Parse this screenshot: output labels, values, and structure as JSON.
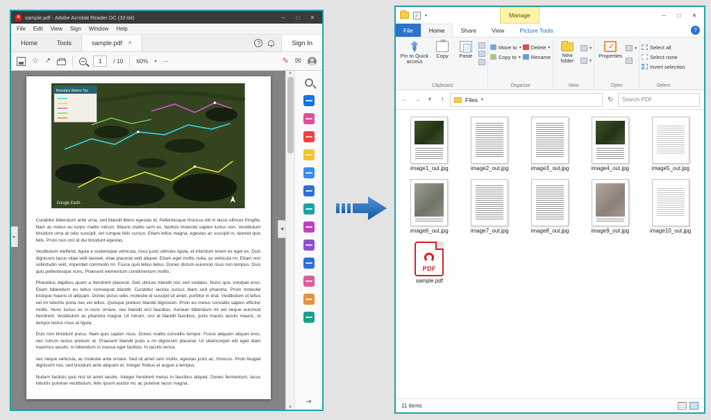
{
  "icons": {
    "minimize": "─",
    "maximize": "□",
    "close": "✕",
    "help": "?",
    "ellipsis": "⋯",
    "chevron": "▾",
    "star": "☆",
    "pen": "✎",
    "mail": "✉",
    "back": "←",
    "forward": "→",
    "up": "↑",
    "refresh": "↻",
    "collapse_left": "◀",
    "panel_arrow": "▸",
    "scroll_up": "▲",
    "scroll_down": "▼",
    "share": "↗",
    "fit": "⇥",
    "pdf_badge": "A"
  },
  "acrobat": {
    "title": "sample.pdf - Adobe Acrobat Reader DC (32-bit)",
    "menu": [
      "File",
      "Edit",
      "View",
      "Sign",
      "Window",
      "Help"
    ],
    "tabs": {
      "home": "Home",
      "tools": "Tools",
      "document": "sample.pdf"
    },
    "sign_in": "Sign In",
    "toolbar": {
      "page_current": "1",
      "page_total": "/ 10",
      "zoom": "60%"
    },
    "document": {
      "map": {
        "legend_title": "Boundary Waters Trip",
        "credit": "Google Earth"
      },
      "paragraphs": [
        "Curabitur bibendum ante urna, sed blandit libero egestas id. Pellentesque rhoncus elit in lacus ultrices fringilla. Nam ac metus eu turpis mattis rutrum. Mauris mattis sem ex, facilisis molestie sapien luctus non. Vestibulum tincidunt urna at odio suscipit, vel congue felis cursus. Etiam tellus magna, egestas ac suscipit in, laoreet quis felis. Proin non orci id dui tincidunt egestas.",
        "Vestibulum eleifend, ligula a scelerisque vehicula, risus justo ultricies ligula, et interdum lorem ex eget ex. Duis dignissim lacus vitae velit laoreet, vitae placerat velit aliquet. Etiam eget mollis nulla, ac vehicula mi. Etiam non sollicitudin velit, imperdiet commodo mi. Fusce quis tellus tellus. Donec dictum euismod risus non tempus. Duis quis pellentesque nunc. Praesent elementum condimentum mollis.",
        "Phasellus dapibus quam a hendrerit placerat. Sed ultrices blandit nisl sed sodales. Nunc quis volutpat eros. Etiam bibendum eu tellus consequat blandit. Curabitur lacinia cursus diam sed pharetra. Proin molestie tristique mauris ut aliquam. Donec purus odio, molestie id suscipit sit amet, porttitor in erat. Vestibulum ut tellus vel mi lobortis porta nec vel tellus. Quisque pretium blandit dignissim. Proin eu metus convallis sapien efficitur mollis. Nunc luctus ex in nunc ornare, nec blandit orci faucibus. Aenean bibendum mi vel neque euismod hendrerit. Vestibulum ac pharetra magna. Ut rutrum, orci at blandit faucibus, justo mauris iaculis mauris, ut tempor lectus risus at ligula.",
        "Duis non tincidunt purus. Nam quis sapien risus. Donec mattis convallis tempor. Fusce aliquam aliquet eros, nec rutrum lectus pretium at. Praesent blandit justo a mi dignissim placerat. Ut ullamcorper elit eget diam maximus iaculis. In bibendum in massa eget facilisis. In iaculis lectus",
        "nec neque vehicula, ac molestie ante ornare. Sed sit amet sem mollis, egestas justo ac, rhoncus. Proin feugiat dignissim nisi, sed tincidunt ante aliquam et. Integer finibus et augue a tempus.",
        "Nullam facilisis quis nisl sit amet iaculis. Integer hendrerit metus in faucibus aliquet. Donec fermentum, lacus lobortis pulvinar vestibulum, felis ipsum auctor mi, ac pulvinar lacus magna."
      ]
    }
  },
  "explorer": {
    "contextual": {
      "group": "Manage",
      "tab": "Picture Tools"
    },
    "tabs": [
      "File",
      "Home",
      "Share",
      "View"
    ],
    "ribbon": {
      "pin": "Pin to Quick access",
      "copy": "Copy",
      "paste": "Paste",
      "move_to": "Move to",
      "copy_to": "Copy to",
      "delete": "Delete",
      "rename": "Rename",
      "new_folder": "New folder",
      "properties": "Properties",
      "select_all": "Select all",
      "select_none": "Select none",
      "invert_selection": "Invert selection",
      "groups": [
        "Clipboard",
        "Organize",
        "New",
        "Open",
        "Select"
      ]
    },
    "address": {
      "location": "Files",
      "search_placeholder": "Search PDF"
    },
    "files": [
      {
        "name": "image1_out.jpg"
      },
      {
        "name": "image2_out.jpg"
      },
      {
        "name": "image3_out.jpg"
      },
      {
        "name": "image4_out.jpg"
      },
      {
        "name": "image5_out.jpg"
      },
      {
        "name": "image6_out.jpg"
      },
      {
        "name": "image7_out.jpg"
      },
      {
        "name": "image8_out.jpg"
      },
      {
        "name": "image9_out.jpg"
      },
      {
        "name": "image10_out.jpg"
      },
      {
        "name": "sample.pdf"
      }
    ],
    "pdf_icon_label": "PDF",
    "status": "11 items"
  }
}
